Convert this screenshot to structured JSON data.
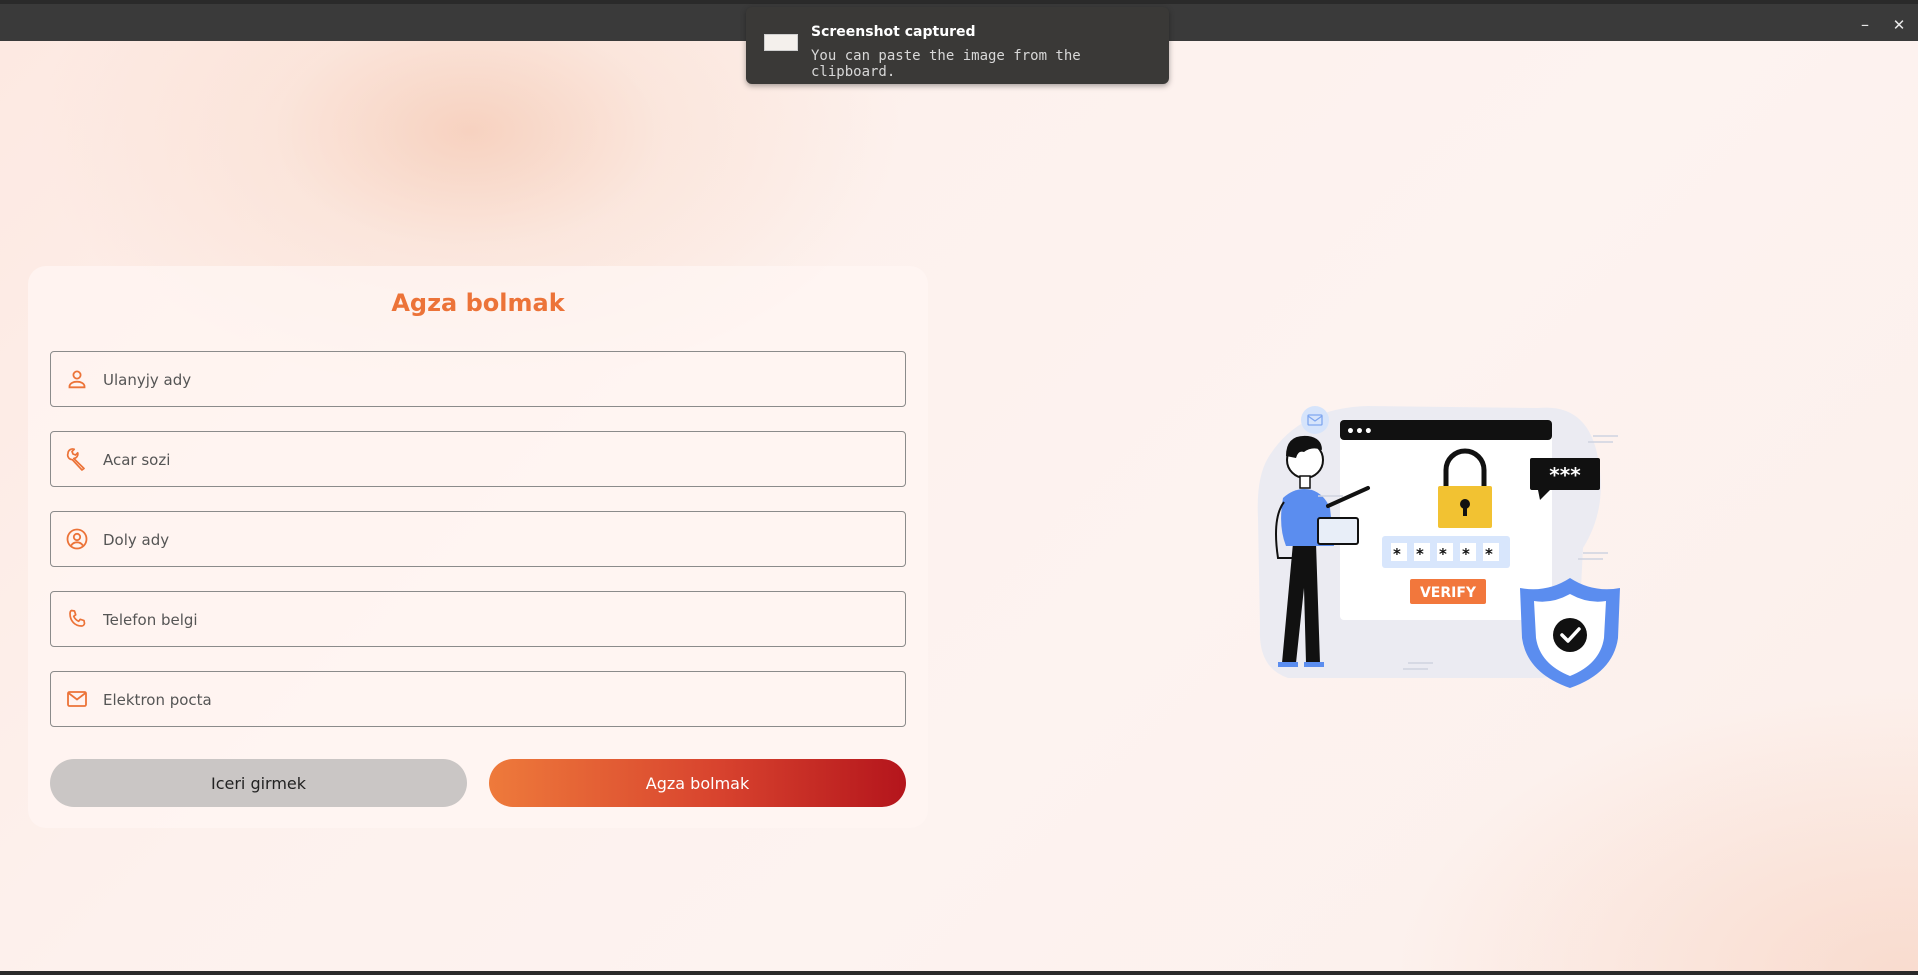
{
  "window": {
    "minimize_icon": "minimize-icon",
    "close_icon": "close-icon"
  },
  "notification": {
    "title": "Screenshot captured",
    "body": "You can paste the image from the clipboard."
  },
  "form": {
    "title": "Agza bolmak",
    "fields": [
      {
        "placeholder": "Ulanyjy ady",
        "value": "",
        "icon": "person-icon"
      },
      {
        "placeholder": "Acar sozi",
        "value": "",
        "icon": "key-icon"
      },
      {
        "placeholder": "Doly ady",
        "value": "",
        "icon": "account-circle-icon"
      },
      {
        "placeholder": "Telefon belgi",
        "value": "",
        "icon": "phone-icon"
      },
      {
        "placeholder": "Elektron pocta",
        "value": "",
        "icon": "mail-icon"
      }
    ],
    "login_label": "Iceri girmek",
    "register_label": "Agza bolmak"
  },
  "illustration": {
    "dots": "•••",
    "password_bubble": "***",
    "pin": [
      "*",
      "*",
      "*",
      "*",
      "*"
    ],
    "verify_label": "VERIFY"
  },
  "colors": {
    "accent": "#ec7338",
    "button_gradient_start": "#ee7a3b",
    "button_gradient_end": "#b4151c",
    "shield": "#5b8def"
  }
}
